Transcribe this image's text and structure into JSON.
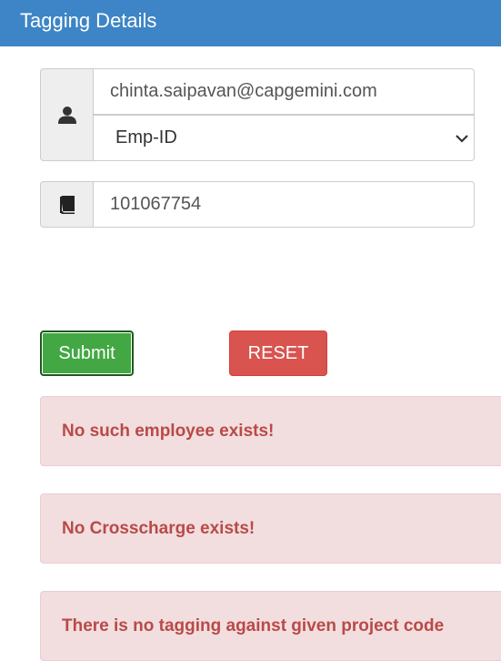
{
  "header": {
    "title": "Tagging Details"
  },
  "form": {
    "email": {
      "value": "chinta.saipavan@capgemini.com"
    },
    "id_type": {
      "selected": "Emp-ID"
    },
    "id_number": {
      "value": "101067754"
    },
    "icons": {
      "user": "user-icon",
      "book": "book-icon",
      "select": "chevron-down-icon"
    }
  },
  "buttons": {
    "submit_label": "Submit",
    "reset_label": "RESET",
    "submit_color": "#43a843",
    "reset_color": "#d9534f"
  },
  "alerts": [
    {
      "text": "No such employee exists!"
    },
    {
      "text": "No Crosscharge exists!"
    },
    {
      "text": "There is no tagging against given project code"
    }
  ],
  "colors": {
    "header_bg": "#3d85c6",
    "alert_bg": "#f2dede",
    "alert_text": "#b94a48"
  }
}
